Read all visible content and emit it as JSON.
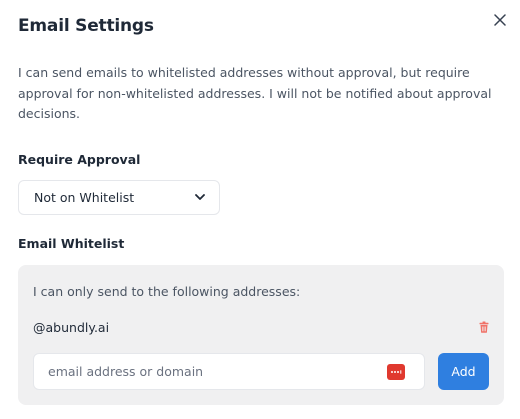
{
  "dialog": {
    "title": "Email Settings",
    "description": "I can send emails to whitelisted addresses without approval, but require approval for non-whitelisted addresses. I will not be notified about approval decisions."
  },
  "approval": {
    "label": "Require Approval",
    "selected": "Not on Whitelist"
  },
  "whitelist": {
    "label": "Email Whitelist",
    "intro": "I can only send to the following addresses:",
    "entries": [
      {
        "address": "@abundly.ai"
      }
    ],
    "input_placeholder": "email address or domain",
    "add_label": "Add"
  },
  "icons": {
    "close": "close-icon",
    "select_chevron": "chevron-down-icon",
    "delete": "trash-icon",
    "password_manager": "password-manager-icon"
  },
  "colors": {
    "primary": "#2f7fe0",
    "danger": "#e0392f",
    "panel_bg": "#f0f0f1",
    "text": "#1f2937",
    "muted_text": "#4b5563"
  }
}
